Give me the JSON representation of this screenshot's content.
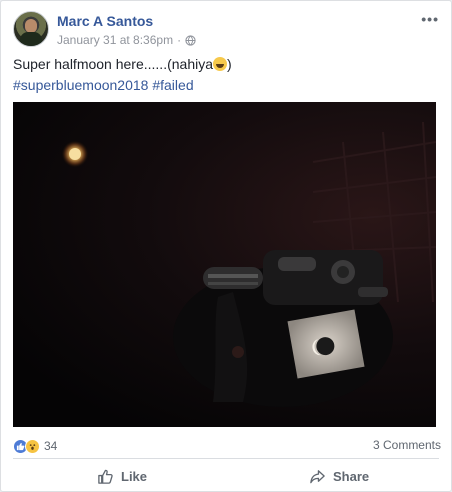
{
  "post": {
    "author": "Marc A Santos",
    "timestamp": "January 31 at 8:36pm",
    "privacy_sep": "·",
    "text_before_emoji": "Super halfmoon here......(nahiya",
    "text_after_emoji": ")",
    "hashtags": [
      "#superbluemoon2018",
      "#failed"
    ],
    "more_label": "•••"
  },
  "stats": {
    "reaction_count": "34",
    "comments": "3 Comments"
  },
  "actions": {
    "like_label": "Like",
    "share_label": "Share"
  },
  "icons": {
    "more": "more-options-icon",
    "privacy": "globe-icon",
    "like": "thumbs-up-icon",
    "share": "share-arrow-icon",
    "reaction_like": "like-reaction-icon",
    "reaction_wow": "wow-reaction-icon"
  },
  "colors": {
    "link": "#365899",
    "muted": "#90949c",
    "reaction_like": "#4d7bd6",
    "reaction_wow": "#f6c342"
  }
}
